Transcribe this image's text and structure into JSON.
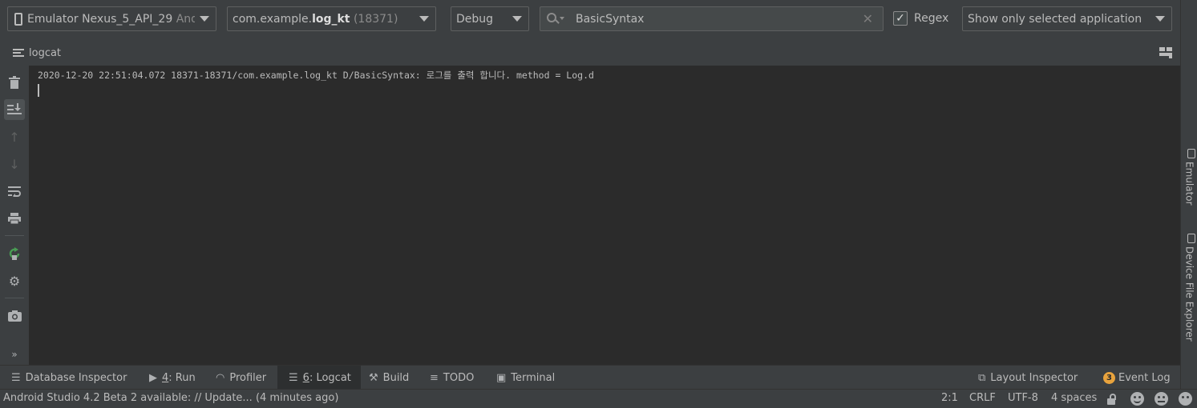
{
  "toolbar": {
    "device": {
      "name": "Emulator Nexus_5_API_29",
      "suffix": "Andro"
    },
    "process": {
      "prefix": "com.example.",
      "bold": "log_kt",
      "pid": "(18371)"
    },
    "log_level": "Debug",
    "search": {
      "value": "BasicSyntax",
      "clear_icon": "close-icon"
    },
    "regex": {
      "label": "Regex",
      "checked": true
    },
    "filter": "Show only selected application"
  },
  "panel": {
    "title": "logcat"
  },
  "side_tools": [
    {
      "name": "clear-logcat",
      "icon": "trash-icon"
    },
    {
      "name": "scroll-to-end",
      "icon": "scroll-to-end-icon",
      "active": true
    },
    {
      "name": "up-stack-trace",
      "icon": "arrow-up-icon",
      "disabled": true
    },
    {
      "name": "down-stack-trace",
      "icon": "arrow-down-icon",
      "disabled": true
    },
    {
      "name": "soft-wraps",
      "icon": "wrap-icon"
    },
    {
      "name": "print",
      "icon": "print-icon"
    },
    {
      "name": "restart",
      "icon": "restart-icon"
    },
    {
      "name": "settings",
      "icon": "gear-icon"
    },
    {
      "name": "screen-capture",
      "icon": "camera-icon"
    },
    {
      "name": "more",
      "icon": "double-chevron-icon",
      "label": "»"
    }
  ],
  "log": {
    "lines": [
      "2020-12-20 22:51:04.072 18371-18371/com.example.log_kt D/BasicSyntax: 로그를 출력 합니다. method = Log.d"
    ]
  },
  "right_strip": {
    "emulator": "Emulator",
    "device_file_explorer": "Device File Explorer"
  },
  "tool_windows": {
    "database_inspector": "Database Inspector",
    "run_num": "4",
    "run": ": Run",
    "profiler": "Profiler",
    "logcat_num": "6",
    "logcat": ": Logcat",
    "build": "Build",
    "todo": "TODO",
    "terminal": "Terminal",
    "layout_inspector": "Layout Inspector",
    "event_log_count": "3",
    "event_log": "Event Log"
  },
  "status": {
    "message": "Android Studio 4.2 Beta 2 available: // Update... (4 minutes ago)",
    "position": "2:1",
    "line_ending": "CRLF",
    "encoding": "UTF-8",
    "indent": "4 spaces"
  },
  "colors": {
    "background": "#3c3f41",
    "editor": "#2b2b2b",
    "text": "#bbbbbb",
    "badge": "#e8a33d",
    "restart_green": "#499c54"
  }
}
